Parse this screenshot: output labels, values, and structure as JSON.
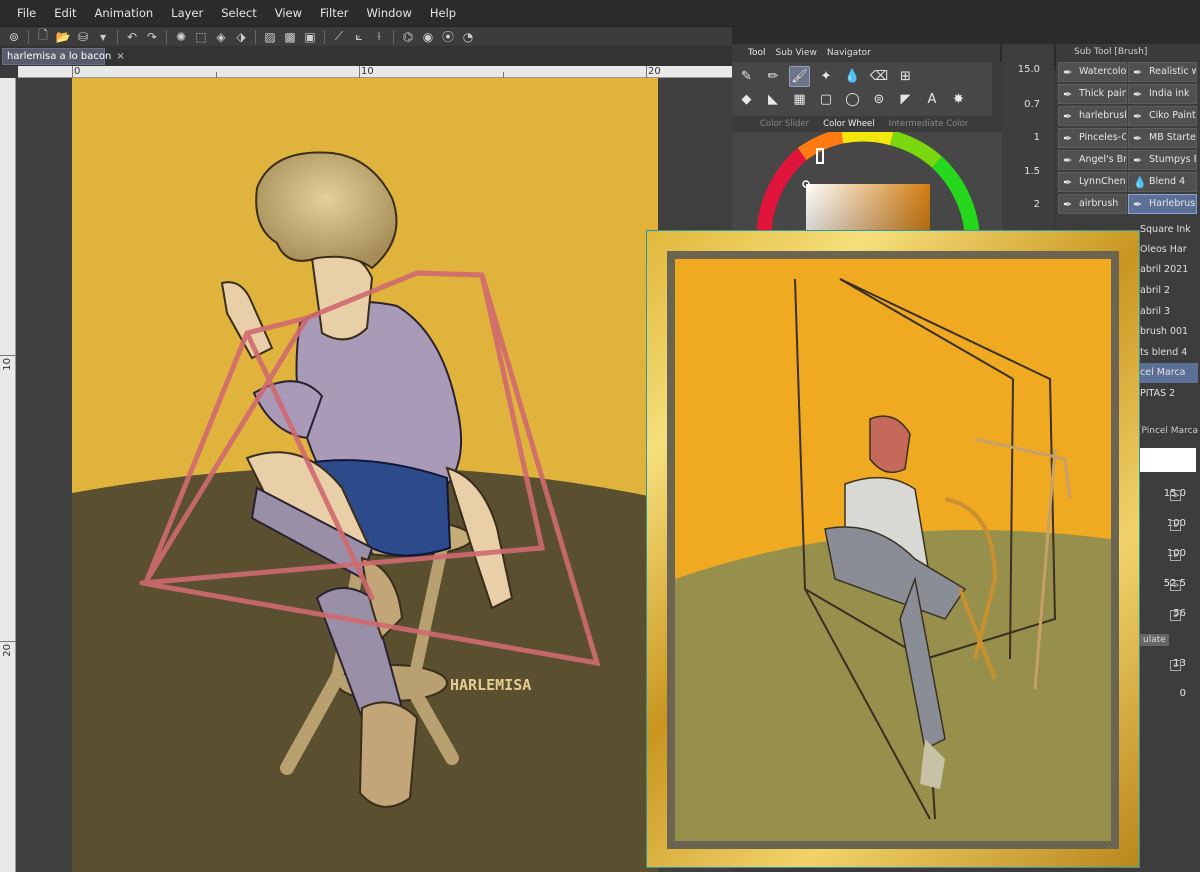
{
  "menu": [
    "File",
    "Edit",
    "Animation",
    "Layer",
    "Select",
    "View",
    "Filter",
    "Window",
    "Help"
  ],
  "document_tab": {
    "title": "harlemisa a lo bacon",
    "close": "×"
  },
  "ruler": {
    "h_labels": [
      "0",
      "10",
      "20"
    ],
    "v_labels": [
      "10",
      "20"
    ]
  },
  "tool_panel": {
    "tabs": [
      "Tool",
      "Sub View",
      "Navigator"
    ]
  },
  "color_panel": {
    "tabs": [
      "Color Slider",
      "Color Wheel",
      "Intermediate Color"
    ]
  },
  "size_values": [
    "15.0",
    "0.7",
    "1",
    "1.5",
    "2"
  ],
  "sub_tool": {
    "header": "Sub Tool [Brush]",
    "brushes": [
      {
        "label": "Watercolor",
        "selected": false
      },
      {
        "label": "Realistic wa",
        "selected": false
      },
      {
        "label": "Thick paint",
        "selected": false
      },
      {
        "label": "India ink",
        "selected": false
      },
      {
        "label": "harlebrushe",
        "selected": false
      },
      {
        "label": "Ciko Paints",
        "selected": false
      },
      {
        "label": "Pinceles-Or",
        "selected": false
      },
      {
        "label": "MB Starter",
        "selected": false
      },
      {
        "label": "Angel's Bru",
        "selected": false
      },
      {
        "label": "Stumpys Bri",
        "selected": false
      },
      {
        "label": "LynnChen E",
        "selected": false
      },
      {
        "label": "Blend 4",
        "selected": false
      },
      {
        "label": "airbrush",
        "selected": false
      },
      {
        "label": "Harlebrush",
        "selected": true
      }
    ],
    "list": [
      {
        "label": "Square Ink",
        "selected": false
      },
      {
        "label": "Oleos Har",
        "selected": false
      },
      {
        "label": "abril 2021",
        "selected": false
      },
      {
        "label": "abril 2",
        "selected": false
      },
      {
        "label": "abril 3",
        "selected": false
      },
      {
        "label": "brush 001",
        "selected": false
      },
      {
        "label": "ts blend 4",
        "selected": false
      },
      {
        "label": "cel Marca",
        "selected": true
      },
      {
        "label": "PITAS 2",
        "selected": false
      }
    ]
  },
  "brush_property": {
    "name": "[Pincel Marca",
    "values": [
      "15.0",
      "100",
      "100",
      "52.5",
      "56",
      "13",
      "0"
    ],
    "button_label": "ulate"
  },
  "artwork": {
    "signature": "HARLEMISA"
  },
  "colors": {
    "canvas_yellow": "#e0b43c",
    "floor_olive": "#5a5030",
    "panel_bg": "#474747",
    "accent_blue": "#5c6f96"
  }
}
